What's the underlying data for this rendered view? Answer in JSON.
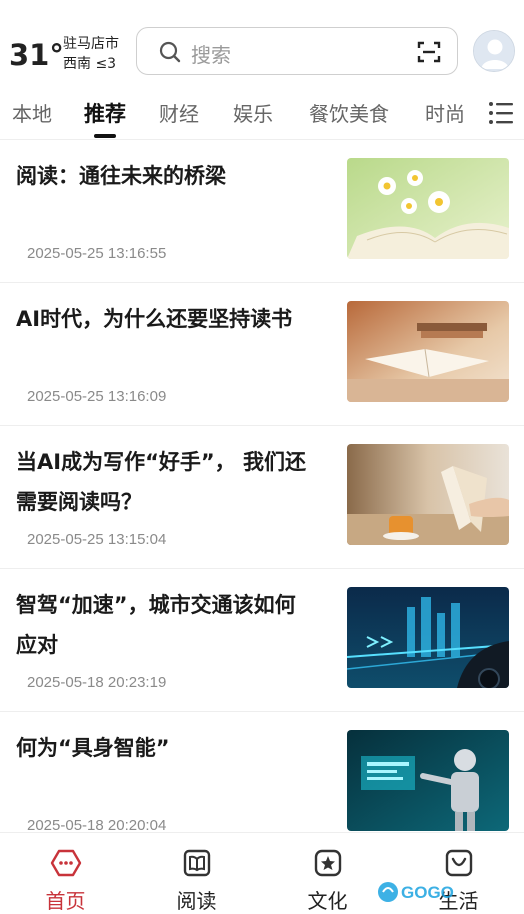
{
  "header": {
    "temperature": "31°",
    "city": "驻马店市",
    "wind": "西南 ≤3",
    "search_placeholder": "搜索",
    "icons": {
      "search": "search-icon",
      "scan": "scan-icon",
      "avatar": "avatar"
    }
  },
  "tabs": [
    {
      "label": "本地"
    },
    {
      "label": "推荐",
      "active": true
    },
    {
      "label": "财经"
    },
    {
      "label": "娱乐"
    },
    {
      "label": "餐饮美食"
    },
    {
      "label": "时尚"
    }
  ],
  "feed": [
    {
      "title": "阅读：通往未来的桥梁",
      "time": "2025-05-25 13:16:55",
      "image": "book-with-daisies"
    },
    {
      "title": "AI时代，为什么还要坚持读书",
      "time": "2025-05-25 13:16:09",
      "image": "open-book-on-table"
    },
    {
      "title": "当AI成为写作“好手”，  我们还需要阅读吗？",
      "time": "2025-05-25 13:15:04",
      "image": "reading-with-coffee"
    },
    {
      "title": "智驾“加速”，城市交通该如何应对",
      "time": "2025-05-18 20:23:19",
      "image": "smart-driving-city"
    },
    {
      "title": "何为“具身智能”",
      "time": "2025-05-18 20:20:04",
      "image": "robot-with-screen"
    }
  ],
  "bottom_nav": [
    {
      "label": "首页",
      "icon": "home-icon",
      "active": true
    },
    {
      "label": "阅读",
      "icon": "book-icon"
    },
    {
      "label": "文化",
      "icon": "star-icon"
    },
    {
      "label": "生活",
      "icon": "bag-icon"
    }
  ],
  "watermark": "GOGO",
  "colors": {
    "accent": "#c8333a",
    "text": "#1a1a1a",
    "muted": "#8a8a8a"
  }
}
